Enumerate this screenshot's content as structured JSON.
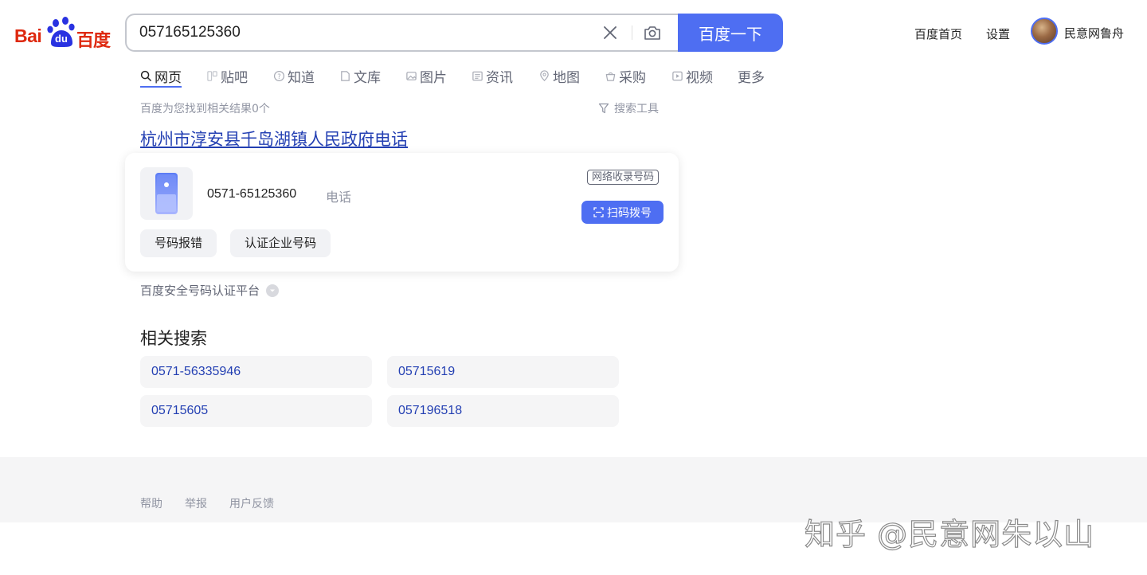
{
  "logo": {
    "text_bai": "Bai",
    "text_du": "du",
    "text_cn": "百度",
    "color": "#de2910"
  },
  "search": {
    "query": "057165125360",
    "button_label": "百度一下"
  },
  "top_nav": {
    "home": "百度首页",
    "settings": "设置",
    "username": "民意网鲁舟"
  },
  "tabs": [
    {
      "label": "网页",
      "icon": "search-icon",
      "active": true
    },
    {
      "label": "贴吧",
      "icon": "tieba-icon"
    },
    {
      "label": "知道",
      "icon": "question-icon"
    },
    {
      "label": "文库",
      "icon": "document-icon"
    },
    {
      "label": "图片",
      "icon": "image-icon"
    },
    {
      "label": "资讯",
      "icon": "news-icon"
    },
    {
      "label": "地图",
      "icon": "map-icon"
    },
    {
      "label": "采购",
      "icon": "basket-icon"
    },
    {
      "label": "视频",
      "icon": "video-icon"
    },
    {
      "label": "更多"
    }
  ],
  "results_meta": {
    "count_text": "百度为您找到相关结果0个",
    "tools_label": "搜索工具"
  },
  "result": {
    "title": "杭州市淳安县千岛湖镇人民政府电话",
    "phone": "0571-65125360",
    "type": "电话",
    "badge": "网络收录号码",
    "scan_button": "扫码拨号",
    "actions": [
      "号码报错",
      "认证企业号码"
    ],
    "platform": "百度安全号码认证平台"
  },
  "related": {
    "title": "相关搜索",
    "items": [
      "0571-56335946",
      "05715619",
      "05715605",
      "057196518"
    ]
  },
  "footer": {
    "links": [
      "帮助",
      "举报",
      "用户反馈"
    ]
  },
  "watermark": "知乎 @民意网朱以山",
  "colors": {
    "accent": "#4e6ef2",
    "link": "#2440b3",
    "muted": "#9195a3"
  }
}
